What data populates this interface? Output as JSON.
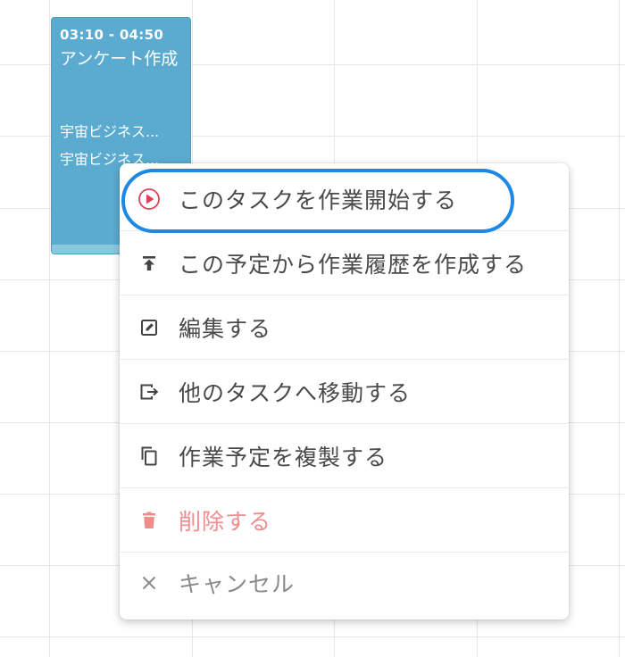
{
  "event": {
    "time": "03:10 - 04:50",
    "title": "アンケート作成",
    "line1": "宇宙ビジネス...",
    "line2": "宇宙ビジネス..."
  },
  "menu": {
    "items": [
      {
        "label": "このタスクを作業開始する",
        "icon": "play-circle-icon"
      },
      {
        "label": "この予定から作業履歴を作成する",
        "icon": "upload-icon"
      },
      {
        "label": "編集する",
        "icon": "edit-icon"
      },
      {
        "label": "他のタスクへ移動する",
        "icon": "move-icon"
      },
      {
        "label": "作業予定を複製する",
        "icon": "copy-icon"
      },
      {
        "label": "削除する",
        "icon": "trash-icon"
      },
      {
        "label": "キャンセル",
        "icon": "close-icon"
      }
    ]
  },
  "colors": {
    "event_bg": "#5aabcf",
    "highlight": "#1e88e5",
    "danger": "#f08c8c",
    "play_icon": "#e0405a"
  }
}
